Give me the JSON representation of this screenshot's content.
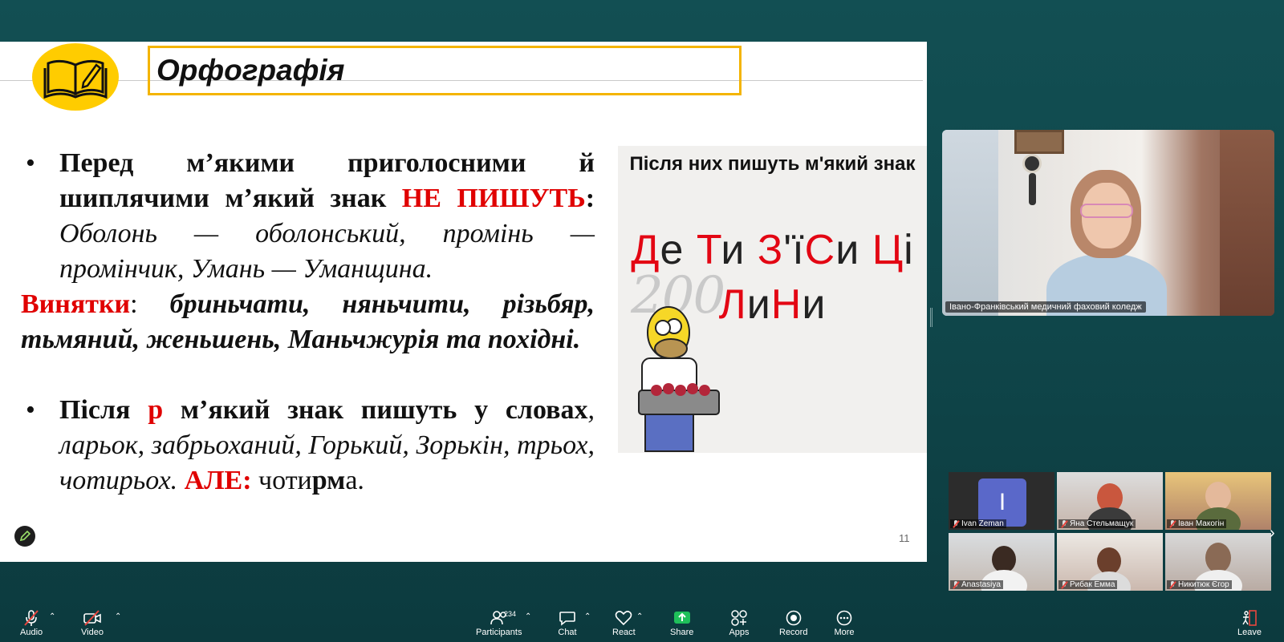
{
  "slide": {
    "title": "Орфографія",
    "slide_number": "11",
    "bullet1": {
      "p1": "Перед м’якими приголосними й шиплячими м’який знак ",
      "red": "НЕ ПИШУТЬ",
      "p2": ":",
      "examples": "Оболонь — оболонський, промінь — промінчик, Умань — Уманщина."
    },
    "exceptions": {
      "label": "Винятки",
      "colon": ": ",
      "words": "бриньчати, няньчити, різьбяр, тьмяний, женьшень, Маньчжурія та похідні."
    },
    "bullet2": {
      "p1": "Після ",
      "red": "р",
      "p2": " м’який знак пишуть у словах",
      "comma": ", ",
      "examples": "ларьок, забрьоханий, Горький, Зорькін, трьох, чотирьох. ",
      "but": "АЛЕ:",
      "tail_a": " чоти",
      "tail_b": "рм",
      "tail_c": "а."
    },
    "illustration": {
      "caption": "Після них пишуть м'який знак",
      "line1": [
        {
          "t": "Д",
          "red": true
        },
        {
          "t": "е ",
          "red": false
        },
        {
          "t": "Т",
          "red": true
        },
        {
          "t": "и ",
          "red": false
        },
        {
          "t": "З",
          "red": true
        },
        {
          "t": "'ї",
          "red": false
        },
        {
          "t": "С",
          "red": true
        },
        {
          "t": "и ",
          "red": false
        },
        {
          "t": "Ц",
          "red": true
        },
        {
          "t": "і",
          "red": false
        }
      ],
      "line2": [
        {
          "t": "Л",
          "red": true
        },
        {
          "t": "и",
          "red": false
        },
        {
          "t": "Н",
          "red": true
        },
        {
          "t": "и",
          "red": false
        }
      ]
    }
  },
  "speaker": {
    "name": "Івано-Франківський медичний фаховий коледж"
  },
  "participants": [
    {
      "name": "Ivan Zeman",
      "initial": "I",
      "muted": true
    },
    {
      "name": "Яна Стельмащук",
      "muted": true
    },
    {
      "name": "Іван Макогін",
      "muted": true
    },
    {
      "name": "Anastasiya",
      "muted": true
    },
    {
      "name": "Рибак Емма",
      "muted": true
    },
    {
      "name": "Никитюк Єгор",
      "muted": true
    }
  ],
  "toolbar": {
    "audio": "Audio",
    "video": "Video",
    "participants": "Participants",
    "participants_count": "234",
    "chat": "Chat",
    "react": "React",
    "share": "Share",
    "apps": "Apps",
    "record": "Record",
    "more": "More",
    "leave": "Leave"
  },
  "colors": {
    "background": "#124f53",
    "accent_red": "#e00000",
    "title_border": "#f4b400",
    "share_green": "#1fbf5a"
  }
}
